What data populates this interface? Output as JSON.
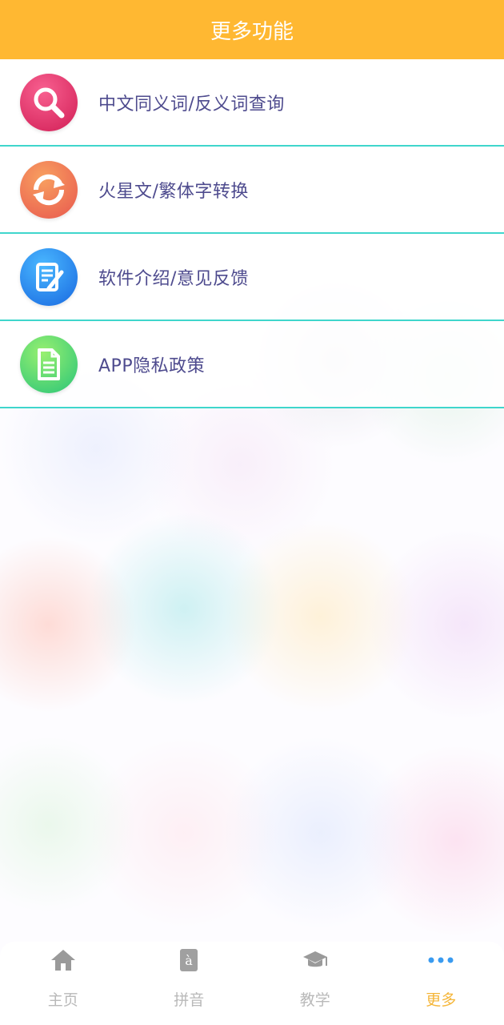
{
  "header": {
    "title": "更多功能"
  },
  "menu": {
    "items": [
      {
        "label": "中文同义词/反义词查询",
        "icon": "search-icon"
      },
      {
        "label": "火星文/繁体字转换",
        "icon": "convert-icon"
      },
      {
        "label": "软件介绍/意见反馈",
        "icon": "feedback-icon"
      },
      {
        "label": "APP隐私政策",
        "icon": "document-icon"
      }
    ]
  },
  "tabbar": {
    "tabs": [
      {
        "label": "主页",
        "icon": "home-icon",
        "active": false
      },
      {
        "label": "拼音",
        "icon": "pinyin-icon",
        "active": false
      },
      {
        "label": "教学",
        "icon": "graduation-cap-icon",
        "active": false
      },
      {
        "label": "更多",
        "icon": "more-dots-icon",
        "active": true
      }
    ]
  },
  "colors": {
    "header_bg": "#ffb832",
    "divider": "#3fd6cc",
    "menu_text": "#4e4b8e",
    "tab_inactive": "#b9b9b9",
    "tab_active": "#f5b63a"
  }
}
